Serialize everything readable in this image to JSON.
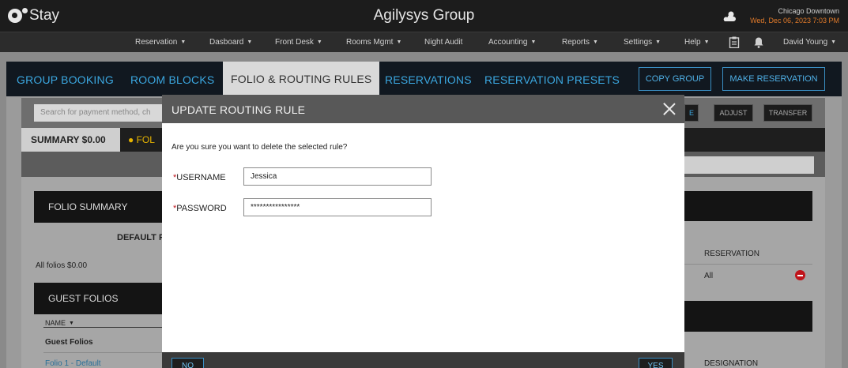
{
  "header": {
    "logo_text": "Stay",
    "app_title": "Agilysys Group",
    "location": "Chicago Downtown",
    "datetime": "Wed, Dec 06, 2023 7:03 PM"
  },
  "nav": {
    "items": [
      {
        "label": "Reservation"
      },
      {
        "label": "Dasboard"
      },
      {
        "label": "Front Desk"
      },
      {
        "label": "Rooms Mgmt"
      },
      {
        "label": "Night Audit"
      },
      {
        "label": "Accounting"
      },
      {
        "label": "Reports"
      },
      {
        "label": "Settings"
      },
      {
        "label": "Help"
      }
    ],
    "user": "David Young"
  },
  "tabs": [
    {
      "label": "GROUP BOOKING"
    },
    {
      "label": "ROOM BLOCKS"
    },
    {
      "label": "FOLIO & ROUTING RULES"
    },
    {
      "label": "RESERVATIONS"
    },
    {
      "label": "RESERVATION PRESETS"
    }
  ],
  "actions": {
    "copy_group": "COPY GROUP",
    "make_reservation": "MAKE RESERVATION"
  },
  "background": {
    "search_placeholder": "Search for payment method, ch",
    "adjust": "ADJUST",
    "transfer": "TRANSFER",
    "e_btn": "E",
    "summary_tab": "SUMMARY $0.00",
    "folio_tab": "FOL",
    "folio_summary": "FOLIO SUMMARY",
    "default_folio": "DEFAULT F",
    "all_folios": "All folios $0.00",
    "guest_folios": "GUEST FOLIOS",
    "name_col": "NAME",
    "guest_folios_row": "Guest Folios",
    "folio1": "Folio 1 - Default",
    "reservation_col": "RESERVATION",
    "reservation_val": "All",
    "designation_col": "DESIGNATION"
  },
  "modal": {
    "title": "UPDATE ROUTING RULE",
    "message": "Are you sure you want to delete the selected rule?",
    "username_label": "USERNAME",
    "username_value": "Jessica",
    "password_label": "PASSWORD",
    "password_value": "****************",
    "required_mark": "*",
    "no_label": "NO",
    "yes_label": "YES"
  },
  "colors": {
    "accent": "#3ba7e0",
    "date_orange": "#e07a2a",
    "required_red": "#c0141b"
  }
}
